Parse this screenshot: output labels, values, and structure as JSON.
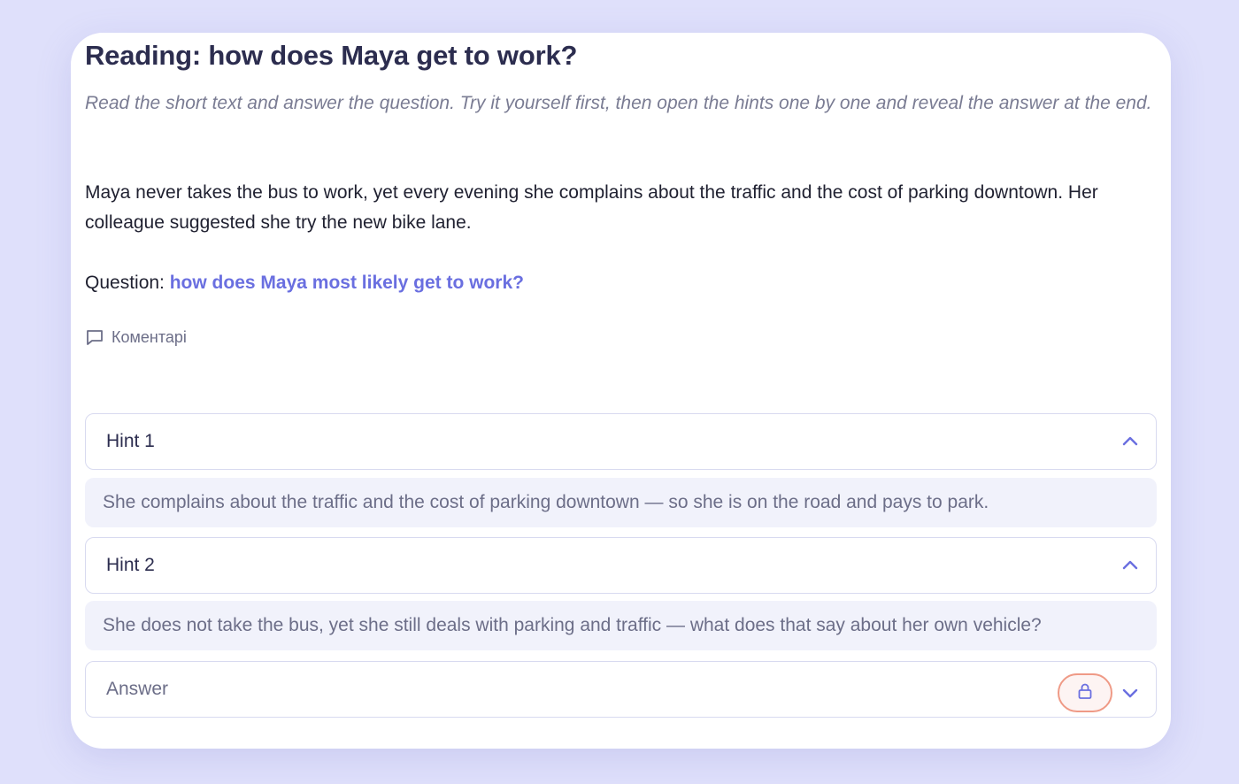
{
  "page": {
    "title": "Reading: how does Maya get to work?",
    "subtitle": "Read the short text and answer the question. Try it yourself first, then open the hints one by one and reveal the answer at the end.",
    "body": "Maya never takes the bus to work, yet every evening she complains about the traffic and the cost of parking downtown. Her colleague suggested she try the new bike lane.",
    "question_prefix": "Question:",
    "question_link": "how does Maya most likely get to work?",
    "comments_label": "Коментарі"
  },
  "hints": [
    {
      "label": "Hint 1",
      "text": "She complains about the traffic and the cost of parking downtown — so she is on the road and pays to park.",
      "expanded": true
    },
    {
      "label": "Hint 2",
      "text": "She does not take the bus, yet she still deals with parking and traffic — what does that say about her own vehicle?",
      "expanded": true
    }
  ],
  "answer": {
    "label": "Answer",
    "locked": true,
    "expanded": false
  },
  "icons": {
    "comment": "comment-icon",
    "chevron_up": "chevron-up-icon",
    "chevron_down": "chevron-down-icon",
    "lock": "lock-icon"
  },
  "colors": {
    "background": "#dfe0fb",
    "card": "#ffffff",
    "accent": "#6a6fe0",
    "lock_border": "#ef9a86",
    "hint_body_bg": "#f1f2fb"
  }
}
